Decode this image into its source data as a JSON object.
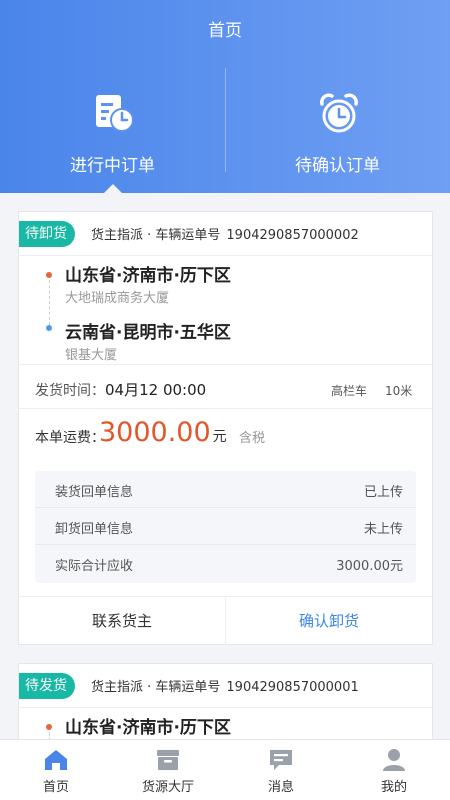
{
  "header": {
    "title": "首页",
    "tabs": [
      {
        "label": "进行中订单",
        "icon": "order-doc-clock-icon"
      },
      {
        "label": "待确认订单",
        "icon": "alarm-clock-icon"
      }
    ]
  },
  "orders": [
    {
      "status": "待卸货",
      "source": "货主指派 · 车辆运单号",
      "order_no": "1904290857000002",
      "from": {
        "place": "山东省·济南市·历下区",
        "address": "大地瑞成商务大厦"
      },
      "to": {
        "place": "云南省·昆明市·五华区",
        "address": "银基大厦"
      },
      "send_time_label": "发货时间：",
      "send_time": "04月12 00:00",
      "truck_type": "高栏车",
      "truck_length": "10米",
      "fee_label": "本单运费：",
      "fee_amount": "3000.00",
      "fee_unit": "元",
      "tax": "含税",
      "receipts": [
        {
          "label": "装货回单信息",
          "value": "已上传"
        },
        {
          "label": "卸货回单信息",
          "value": "未上传"
        },
        {
          "label": "实际合计应收",
          "value": "3000.00元"
        }
      ],
      "actions": {
        "contact": "联系货主",
        "confirm": "确认卸货"
      }
    },
    {
      "status": "待发货",
      "source": "货主指派 · 车辆运单号",
      "order_no": "1904290857000001",
      "from": {
        "place": "山东省·济南市·历下区"
      }
    }
  ],
  "nav": [
    {
      "label": "首页",
      "icon": "home-icon",
      "active": true
    },
    {
      "label": "货源大厅",
      "icon": "box-icon",
      "active": false
    },
    {
      "label": "消息",
      "icon": "message-icon",
      "active": false
    },
    {
      "label": "我的",
      "icon": "user-icon",
      "active": false
    }
  ],
  "colors": {
    "primary": "#4a85ea",
    "accent": "#e2562a",
    "tag": "#19b8a4",
    "link": "#3c86e8"
  }
}
